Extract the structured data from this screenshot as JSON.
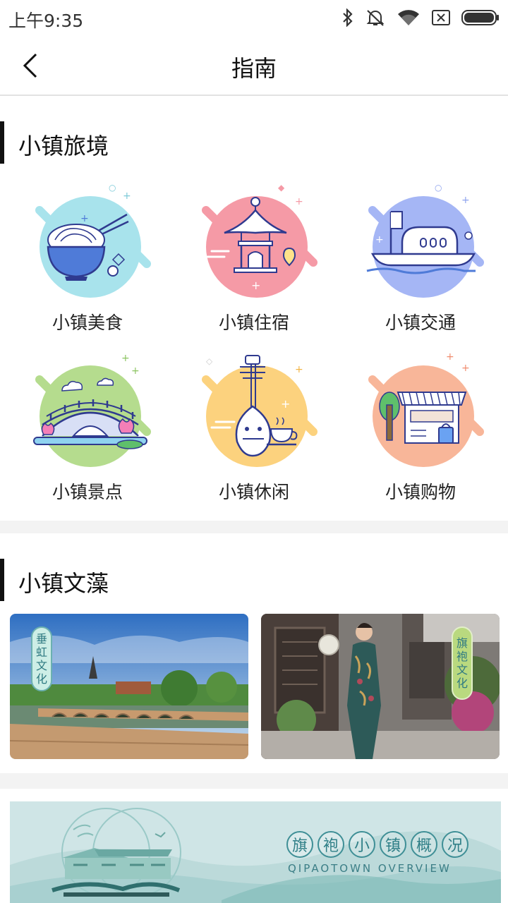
{
  "status": {
    "time": "上午9:35"
  },
  "nav": {
    "title": "指南"
  },
  "section1": {
    "title": "小镇旅境",
    "items": [
      {
        "label": "小镇美食",
        "icon": "noodle-bowl-icon"
      },
      {
        "label": "小镇住宿",
        "icon": "pavilion-icon"
      },
      {
        "label": "小镇交通",
        "icon": "boat-icon"
      },
      {
        "label": "小镇景点",
        "icon": "bridge-icon"
      },
      {
        "label": "小镇休闲",
        "icon": "pipa-icon"
      },
      {
        "label": "小镇购物",
        "icon": "shop-icon"
      }
    ]
  },
  "section2": {
    "title": "小镇文藻",
    "cards": [
      {
        "tag": [
          "垂",
          "虹",
          "文",
          "化"
        ]
      },
      {
        "tag": [
          "旗",
          "袍",
          "文",
          "化"
        ]
      }
    ]
  },
  "banner": {
    "title_chars": [
      "旗",
      "袍",
      "小",
      "镇",
      "概",
      "况"
    ],
    "subtitle": "QIPAOTOWN OVERVIEW"
  },
  "colors": {
    "food": "#a8e3ec",
    "lodging": "#f59aa6",
    "transport": "#a5b6f5",
    "sights": "#b5dc8e",
    "leisure": "#fcd27e",
    "shopping": "#f8b699",
    "icon_line": "#2f3a8f",
    "section_bar": "#111111",
    "divider": "#f3f3f3"
  }
}
